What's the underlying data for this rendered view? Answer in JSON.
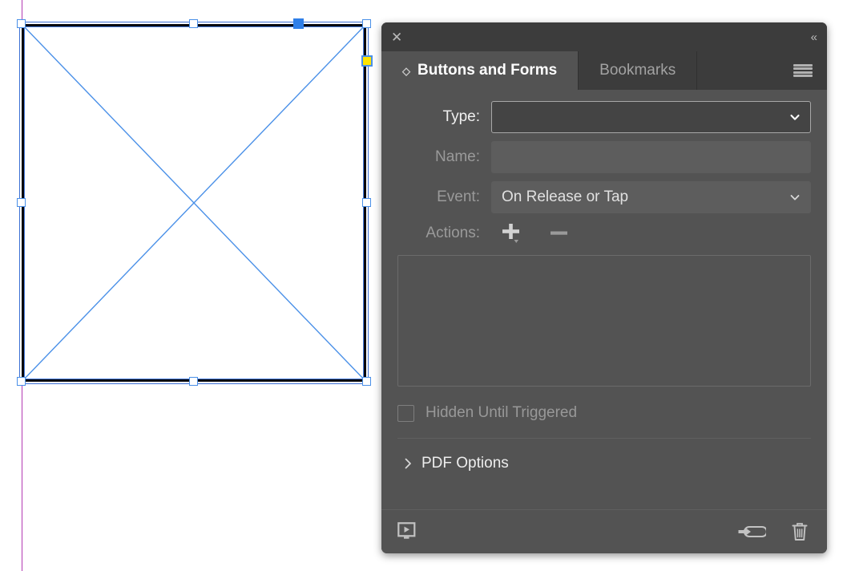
{
  "canvas": {
    "guide": {
      "name": "vertical-ruler-guide",
      "color": "#b33ab3"
    },
    "frame": {
      "name": "empty-graphic-frame",
      "stroke_color": "#07070e",
      "selection_color": "#4a90e8",
      "cross_color": "#4a90e8"
    },
    "handles": [
      {
        "name": "handle-top-left",
        "kind": "hollow"
      },
      {
        "name": "handle-top-center",
        "kind": "hollow"
      },
      {
        "name": "handle-top-right",
        "kind": "hollow"
      },
      {
        "name": "handle-middle-left",
        "kind": "hollow"
      },
      {
        "name": "handle-middle-right",
        "kind": "hollow"
      },
      {
        "name": "handle-bottom-left",
        "kind": "hollow"
      },
      {
        "name": "handle-bottom-center",
        "kind": "hollow"
      },
      {
        "name": "handle-bottom-right",
        "kind": "hollow"
      },
      {
        "name": "handle-text-flow-in",
        "kind": "filled",
        "color": "#2f7fe8"
      },
      {
        "name": "handle-content-grabber",
        "kind": "yellow",
        "color": "#ffe400"
      }
    ]
  },
  "panel": {
    "titlebar": {
      "close_glyph": "✕",
      "collapse_glyph": "«"
    },
    "tabs": [
      {
        "label": "Buttons and Forms",
        "active": true,
        "caret": "◇"
      },
      {
        "label": "Bookmarks",
        "active": false
      }
    ],
    "menu_icon": "hamburger-menu-icon",
    "form": {
      "type": {
        "label": "Type:",
        "value": "",
        "placeholder": ""
      },
      "name": {
        "label": "Name:",
        "value": "",
        "placeholder": ""
      },
      "event": {
        "label": "Event:",
        "value": "On Release or Tap"
      },
      "actions": {
        "label": "Actions:",
        "add": "+",
        "remove": "−",
        "items": []
      }
    },
    "hidden_until_triggered": {
      "label": "Hidden Until Triggered",
      "checked": false
    },
    "pdf_options": {
      "label": "PDF Options",
      "expanded": false
    },
    "footer": {
      "preview": "preview-spread-icon",
      "convert": "convert-to-button-icon",
      "delete": "delete-icon"
    }
  },
  "colors": {
    "panel_bg": "#535353",
    "titlebar_bg": "#3c3c3c",
    "field_bg": "#5d5d5d",
    "field_active_bg": "#444444",
    "accent_selection": "#4a90e8",
    "guide": "#b33ab3",
    "content_grabber": "#ffe400"
  }
}
